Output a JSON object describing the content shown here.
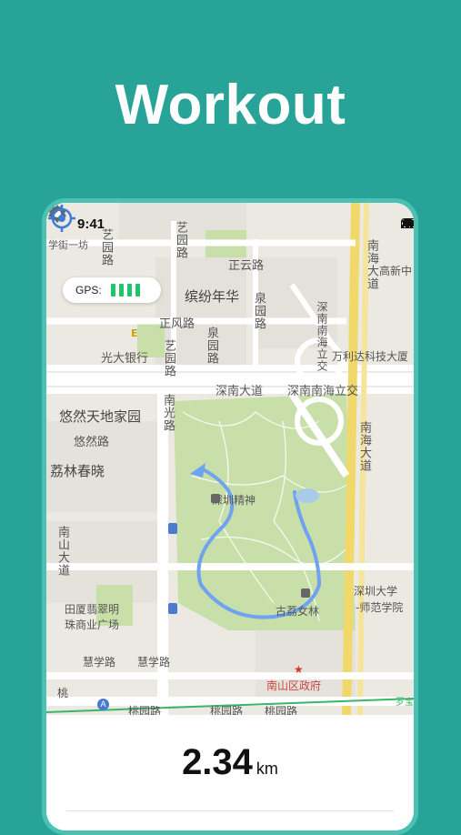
{
  "headline": "Workout",
  "status": {
    "time": "9:41"
  },
  "gps": {
    "label": "GPS:"
  },
  "map_labels": {
    "a": "学街一坊",
    "b": "艺园路",
    "c": "正云路",
    "d": "缤纷年华",
    "e": "泉园路",
    "f": "正风路",
    "g": "泉园路",
    "h": "光大银行",
    "i": "艺园路",
    "j": "深南大道",
    "k": "深南南海立交",
    "l": "悠然天地家园",
    "m": "悠然路",
    "n": "南光路",
    "o": "荔林春晓",
    "p": "深圳精神",
    "q": "南山大道",
    "r": "田厦翡翠明",
    "s": "珠商业广场",
    "t": "古荔女林",
    "u": "深圳大学",
    "v": "-师范学院",
    "w": "慧学路",
    "x": "慧学路",
    "y": "南山区政府",
    "z": "桃园路",
    "aa": "桃园路",
    "ab": "桃园路",
    "ac": "南海大道",
    "ad": "南海大道",
    "ae": "万利达科技大厦",
    "af": "高新中",
    "ag": "南海大道",
    "ah": "深南南海立交",
    "ai": "桃",
    "aj": "罗宝",
    "ak": "南海大道",
    "al": "南",
    "am": "E"
  },
  "workout": {
    "distance": "2.34",
    "unit": "km"
  },
  "colors": {
    "background": "#27a397",
    "route": "#6fa3f0",
    "park": "#c8dfaa",
    "gps_bars": "#1fc46b"
  },
  "icons": [
    "signal-icon",
    "wifi-icon",
    "battery-icon",
    "gear-icon",
    "locate-icon",
    "museum-icon",
    "government-star-icon",
    "bus-icon",
    "metro-icon",
    "arrow-icon"
  ]
}
